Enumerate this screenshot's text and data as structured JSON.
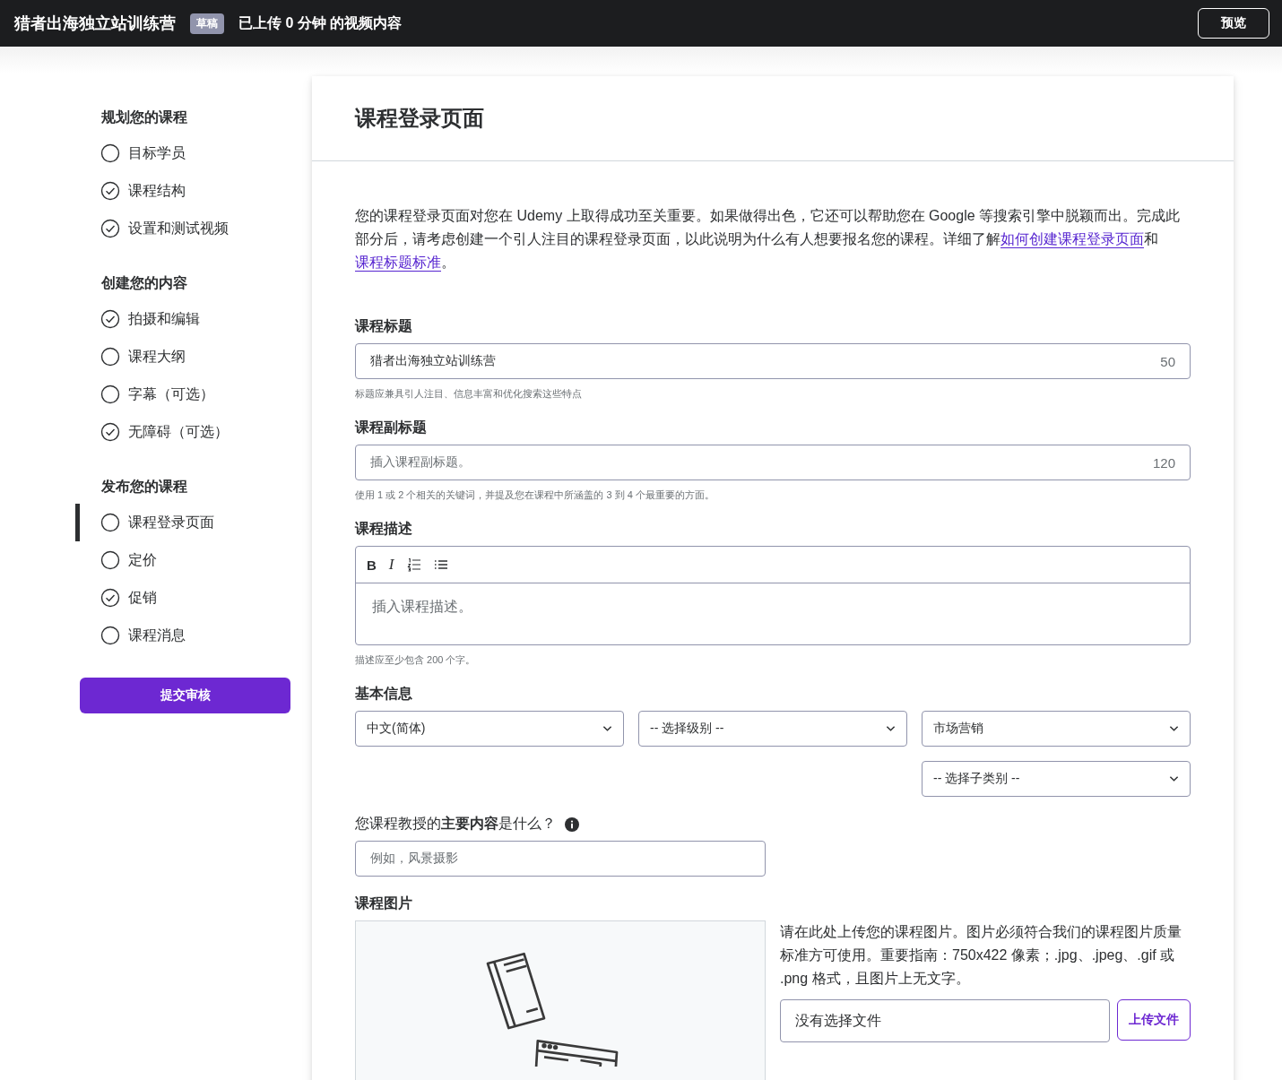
{
  "header": {
    "title": "猎者出海独立站训练营",
    "badge": "草稿",
    "status": "已上传 0 分钟 的视频内容",
    "preview_button": "预览"
  },
  "sidebar": {
    "groups": [
      {
        "title": "规划您的课程",
        "items": [
          {
            "label": "目标学员",
            "checked": false,
            "selected": false
          },
          {
            "label": "课程结构",
            "checked": true,
            "selected": false
          },
          {
            "label": "设置和测试视频",
            "checked": true,
            "selected": false
          }
        ]
      },
      {
        "title": "创建您的内容",
        "items": [
          {
            "label": "拍摄和编辑",
            "checked": true,
            "selected": false
          },
          {
            "label": "课程大纲",
            "checked": false,
            "selected": false
          },
          {
            "label": "字幕（可选）",
            "checked": false,
            "selected": false
          },
          {
            "label": "无障碍（可选）",
            "checked": true,
            "selected": false
          }
        ]
      },
      {
        "title": "发布您的课程",
        "items": [
          {
            "label": "课程登录页面",
            "checked": false,
            "selected": true
          },
          {
            "label": "定价",
            "checked": false,
            "selected": false
          },
          {
            "label": "促销",
            "checked": true,
            "selected": false
          },
          {
            "label": "课程消息",
            "checked": false,
            "selected": false
          }
        ]
      }
    ],
    "submit_button": "提交审核"
  },
  "main": {
    "title": "课程登录页面",
    "intro": [
      {
        "kind": "text",
        "text": "您的课程登录页面对您在 Udemy 上取得成功至关重要。如果做得出色，它还可以帮助您在 Google 等搜索引擎中脱颖而出。完成此部分后，请考虑创建一个引人注目的课程登录页面，以此说明为什么有人想要报名您的课程。详细了解"
      },
      {
        "kind": "link",
        "text": "如何创建课程登录页面"
      },
      {
        "kind": "text",
        "text": "和 "
      },
      {
        "kind": "link",
        "text": "课程标题标准"
      },
      {
        "kind": "text",
        "text": "。"
      }
    ],
    "course_title": {
      "label": "课程标题",
      "value": "猎者出海独立站训练营",
      "counter": "50",
      "hint": "标题应兼具引人注目、信息丰富和优化搜索这些特点"
    },
    "course_subtitle": {
      "label": "课程副标题",
      "placeholder": "插入课程副标题。",
      "counter": "120",
      "hint": "使用 1 或 2 个相关的关键词，并提及您在课程中所涵盖的 3 到 4 个最重要的方面。"
    },
    "course_description": {
      "label": "课程描述",
      "toolbar": [
        {
          "kind": "bold",
          "label": "B"
        },
        {
          "kind": "italic",
          "label": "I"
        },
        {
          "kind": "ordered-list"
        },
        {
          "kind": "bullet-list"
        }
      ],
      "placeholder": "插入课程描述。",
      "hint": "描述应至少包含 200 个字。"
    },
    "basic_info": {
      "label": "基本信息",
      "selects": [
        {
          "value": "中文(简体)"
        },
        {
          "value": "-- 选择级别 --"
        },
        {
          "value": "市场营销"
        },
        {
          "value": "-- 选择子类别 --"
        }
      ]
    },
    "main_topic": {
      "label": "您课程教授的**主要内容**是什么？",
      "placeholder": "例如，风景摄影"
    },
    "course_image": {
      "label": "课程图片",
      "description": "请在此处上传您的课程图片。图片必须符合我们的课程图片质量标准方可使用。重要指南：750x422 像素；.jpg、.jpeg、.gif 或 .png 格式，且图片上无文字。",
      "file_value": "没有选择文件",
      "upload_button": "上传文件"
    }
  }
}
